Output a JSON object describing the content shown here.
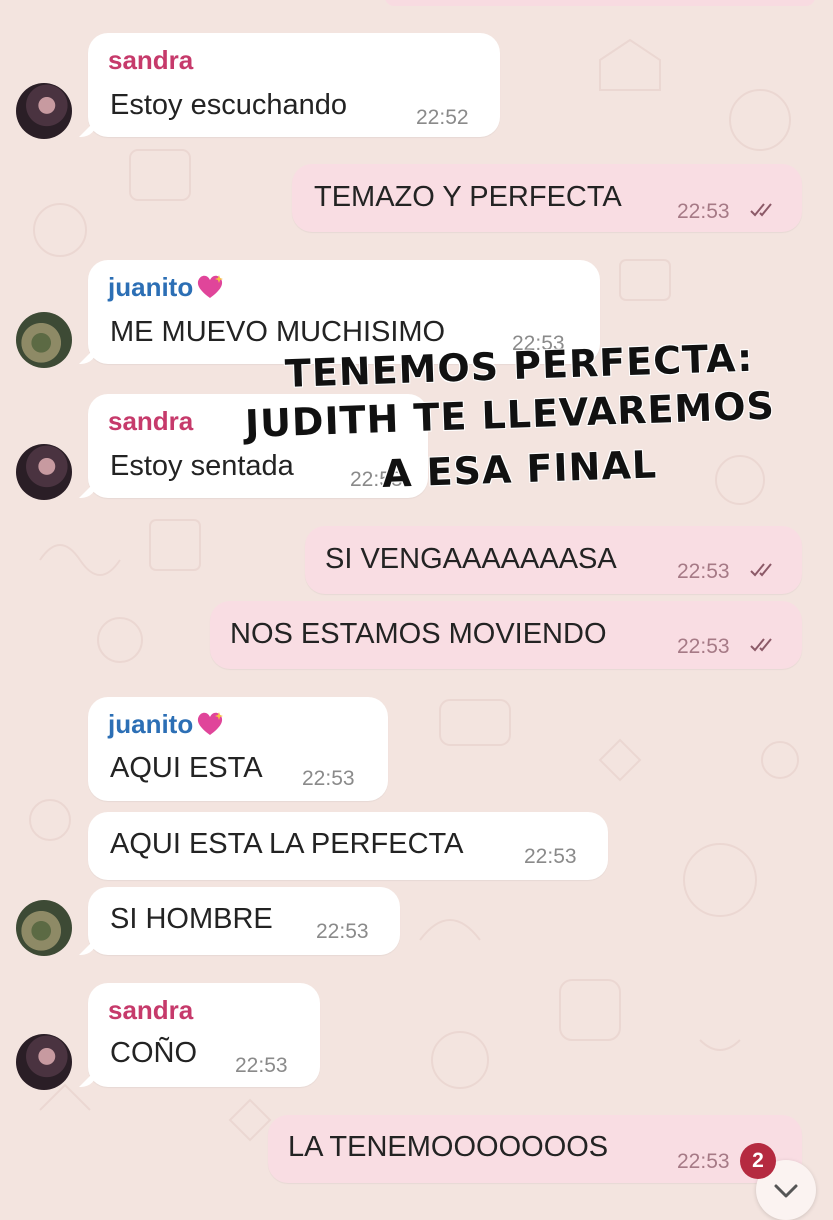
{
  "messages": [
    {
      "sender": "sandra",
      "text": "Estoy escuchando",
      "time": "22:52"
    },
    {
      "text": "TEMAZO Y PERFECTA",
      "time": "22:53"
    },
    {
      "sender": "juanito",
      "text": "ME MUEVO MUCHISIMO",
      "time": "22:53"
    },
    {
      "sender": "sandra",
      "text": "Estoy sentada",
      "time": "22:53"
    },
    {
      "text": "SI VENGAAAAAAASA",
      "time": "22:53"
    },
    {
      "text": "NOS ESTAMOS MOVIENDO",
      "time": "22:53"
    },
    {
      "sender": "juanito",
      "text": "AQUI ESTA",
      "time": "22:53"
    },
    {
      "text": "AQUI ESTA LA PERFECTA",
      "time": "22:53"
    },
    {
      "text": "SI HOMBRE",
      "time": "22:53"
    },
    {
      "sender": "sandra",
      "text": "COÑO",
      "time": "22:53"
    },
    {
      "text": "LA TENEMOOOOOOOS",
      "time": "22:53"
    }
  ],
  "overlay": {
    "line1": "TENEMOS PERFECTA:",
    "line2": "JUDITH TE LLEVAREMOS",
    "line3": "A ESA FINAL"
  },
  "unread_count": "2",
  "icons": {
    "read": "double-check-icon",
    "heart": "sparkling-heart-icon",
    "scroll": "chevron-down-icon"
  },
  "colors": {
    "incoming_bubble": "#ffffff",
    "outgoing_bubble": "#f9dde3",
    "sandra_name": "#c63a6b",
    "juanito_name": "#2c6fb5",
    "badge": "#b52a40"
  }
}
